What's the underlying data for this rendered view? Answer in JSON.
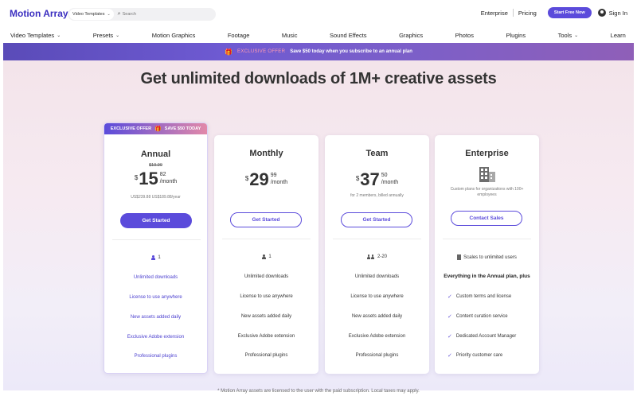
{
  "header": {
    "logo": "Motion Array",
    "search": {
      "category": "Video Templates",
      "placeholder": "Search"
    },
    "links": {
      "enterprise": "Enterprise",
      "pricing": "Pricing"
    },
    "start_button": "Start Free Now",
    "sign_in": "Sign In"
  },
  "nav": [
    {
      "label": "Video Templates",
      "dropdown": true
    },
    {
      "label": "Presets",
      "dropdown": true
    },
    {
      "label": "Motion Graphics",
      "dropdown": false
    },
    {
      "label": "Footage",
      "dropdown": false
    },
    {
      "label": "Music",
      "dropdown": false
    },
    {
      "label": "Sound Effects",
      "dropdown": false
    },
    {
      "label": "Graphics",
      "dropdown": false
    },
    {
      "label": "Photos",
      "dropdown": false
    },
    {
      "label": "Plugins",
      "dropdown": false
    },
    {
      "label": "Tools",
      "dropdown": true
    },
    {
      "label": "Learn",
      "dropdown": false
    }
  ],
  "promo": {
    "tag": "EXCLUSIVE OFFER",
    "message": "Save $50 today when you subscribe to an annual plan"
  },
  "title": "Get unlimited downloads of 1M+ creative assets",
  "plans": {
    "annual": {
      "banner_left": "EXCLUSIVE OFFER",
      "banner_right": "SAVE $50 TODAY",
      "name": "Annual",
      "old_price": "$19.99",
      "currency": "$",
      "dollars": "15",
      "cents": "82",
      "per": "/month",
      "note": "US$239.88 US$189.88/year",
      "button": "Get Started",
      "seats": "1",
      "features": [
        "Unlimited downloads",
        "License to use anywhere",
        "New assets added daily",
        "Exclusive Adobe extension",
        "Professional plugins"
      ]
    },
    "monthly": {
      "name": "Monthly",
      "currency": "$",
      "dollars": "29",
      "cents": "99",
      "per": "/month",
      "button": "Get Started",
      "seats": "1",
      "features": [
        "Unlimited downloads",
        "License to use anywhere",
        "New assets added daily",
        "Exclusive Adobe extension",
        "Professional plugins"
      ]
    },
    "team": {
      "name": "Team",
      "currency": "$",
      "dollars": "37",
      "cents": "50",
      "per": "/month",
      "note": "for 2 members, billed annually",
      "button": "Get Started",
      "seats": "2-20",
      "features": [
        "Unlimited downloads",
        "License to use anywhere",
        "New assets added daily",
        "Exclusive Adobe extension",
        "Professional plugins"
      ]
    },
    "enterprise": {
      "name": "Enterprise",
      "description": "Custom plans for organizations with 100+ employees",
      "button": "Contact Sales",
      "scale": "Scales to unlimited users",
      "includes": "Everything in the Annual plan, plus",
      "features": [
        "Custom terms and license",
        "Content curation service",
        "Dedicated Account Manager",
        "Priority customer care"
      ]
    }
  },
  "footnote": "* Motion Array assets are licensed to the user with the paid subscription. Local taxes may apply."
}
